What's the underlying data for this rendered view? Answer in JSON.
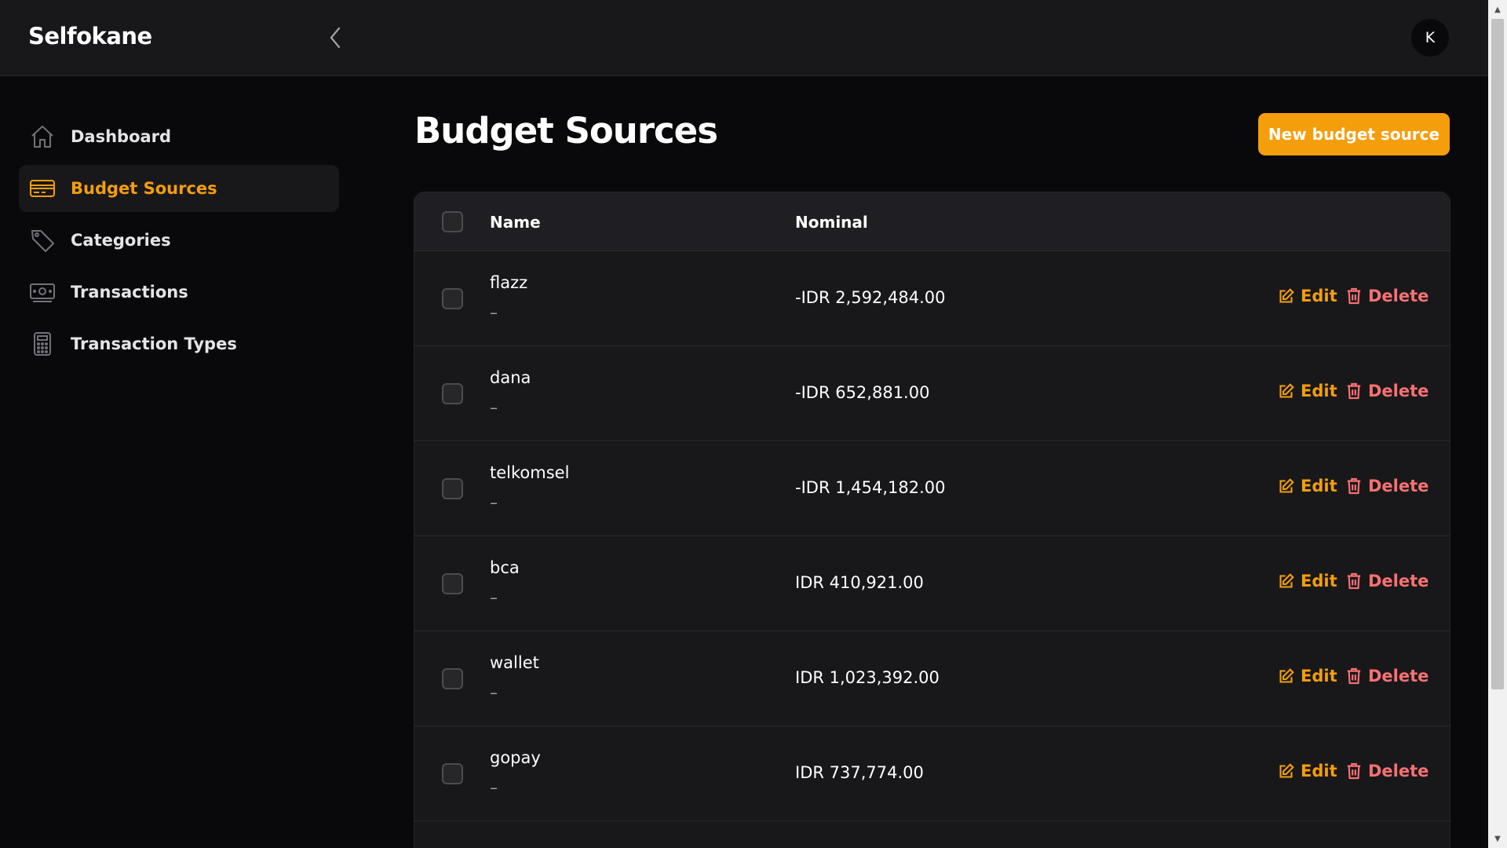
{
  "app": {
    "brand": "Selfokane",
    "avatar_initial": "K",
    "accent_color": "#f59e0b",
    "danger_color": "#f87171"
  },
  "sidebar": {
    "items": [
      {
        "label": "Dashboard",
        "icon": "home-icon",
        "active": false
      },
      {
        "label": "Budget Sources",
        "icon": "credit-card-icon",
        "active": true
      },
      {
        "label": "Categories",
        "icon": "tag-icon",
        "active": false
      },
      {
        "label": "Transactions",
        "icon": "cash-icon",
        "active": false
      },
      {
        "label": "Transaction Types",
        "icon": "calculator-icon",
        "active": false
      }
    ]
  },
  "page": {
    "title": "Budget Sources",
    "new_button_label": "New budget source"
  },
  "table": {
    "columns": {
      "name": "Name",
      "nominal": "Nominal"
    },
    "edit_label": "Edit",
    "delete_label": "Delete",
    "rows": [
      {
        "name": "flazz",
        "description": "–",
        "nominal": "-IDR 2,592,484.00"
      },
      {
        "name": "dana",
        "description": "–",
        "nominal": "-IDR 652,881.00"
      },
      {
        "name": "telkomsel",
        "description": "–",
        "nominal": "-IDR 1,454,182.00"
      },
      {
        "name": "bca",
        "description": "–",
        "nominal": "IDR 410,921.00"
      },
      {
        "name": "wallet",
        "description": "–",
        "nominal": "IDR 1,023,392.00"
      },
      {
        "name": "gopay",
        "description": "–",
        "nominal": "IDR 737,774.00"
      }
    ]
  }
}
